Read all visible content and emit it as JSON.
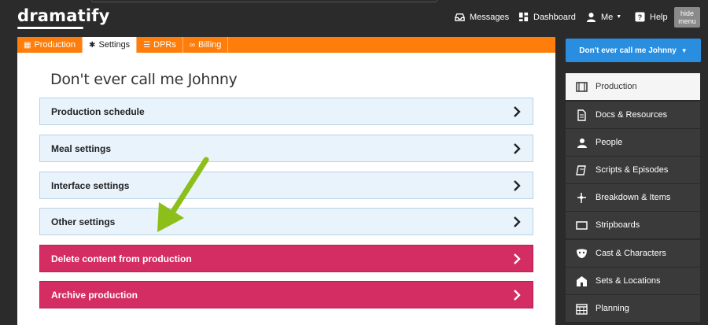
{
  "brand": {
    "logo": "dramatify"
  },
  "topnav": {
    "messages": "Messages",
    "dashboard": "Dashboard",
    "me": "Me",
    "help": "Help",
    "hide_menu": "hide menu"
  },
  "tabs": [
    {
      "label": "Production",
      "icon": "film-icon"
    },
    {
      "label": "Settings",
      "icon": "gear-icon"
    },
    {
      "label": "DPRs",
      "icon": "list-icon"
    },
    {
      "label": "Billing",
      "icon": "link-icon"
    }
  ],
  "page": {
    "title": "Don't ever call me Johnny"
  },
  "settings_rows": [
    {
      "label": "Production schedule",
      "style": "light"
    },
    {
      "label": "Meal settings",
      "style": "light"
    },
    {
      "label": "Interface settings",
      "style": "light"
    },
    {
      "label": "Other settings",
      "style": "light"
    },
    {
      "label": "Delete content from production",
      "style": "pink"
    },
    {
      "label": "Archive production",
      "style": "pink"
    }
  ],
  "sidebar": {
    "project_button": "Don't ever call me Johnny",
    "items": [
      {
        "label": "Production",
        "icon": "film-icon"
      },
      {
        "label": "Docs & Resources",
        "icon": "document-icon"
      },
      {
        "label": "People",
        "icon": "people-icon"
      },
      {
        "label": "Scripts & Episodes",
        "icon": "script-icon"
      },
      {
        "label": "Breakdown & Items",
        "icon": "breakdown-icon"
      },
      {
        "label": "Stripboards",
        "icon": "stripboard-icon"
      },
      {
        "label": "Cast & Characters",
        "icon": "masks-icon"
      },
      {
        "label": "Sets & Locations",
        "icon": "location-icon"
      },
      {
        "label": "Planning",
        "icon": "calendar-icon"
      }
    ]
  },
  "colors": {
    "tab_bar": "#ff7d0a",
    "primary_button": "#2a8ee0",
    "danger_row": "#d42d63",
    "light_row": "#e9f3fc",
    "arrow": "#8cbf1a"
  }
}
